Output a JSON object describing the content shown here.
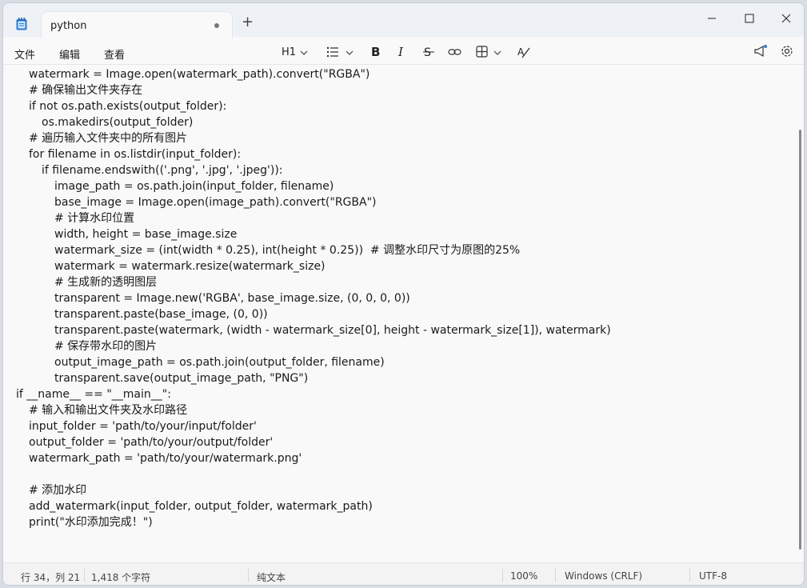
{
  "tab": {
    "title": "python"
  },
  "menu": {
    "file": "文件",
    "edit": "编辑",
    "view": "查看"
  },
  "toolbar": {
    "heading": "H1"
  },
  "code_lines": [
    {
      "indent": 1,
      "text": "watermark = Image.open(watermark_path).convert(\"RGBA\")"
    },
    {
      "indent": 1,
      "text": "# 确保输出文件夹存在"
    },
    {
      "indent": 1,
      "text": "if not os.path.exists(output_folder):"
    },
    {
      "indent": 2,
      "text": "os.makedirs(output_folder)"
    },
    {
      "indent": 1,
      "text": "# 遍历输入文件夹中的所有图片"
    },
    {
      "indent": 1,
      "text": "for filename in os.listdir(input_folder):"
    },
    {
      "indent": 2,
      "text": "if filename.endswith(('.png', '.jpg', '.jpeg')):"
    },
    {
      "indent": 3,
      "text": "image_path = os.path.join(input_folder, filename)"
    },
    {
      "indent": 3,
      "text": "base_image = Image.open(image_path).convert(\"RGBA\")"
    },
    {
      "indent": 3,
      "text": "# 计算水印位置"
    },
    {
      "indent": 3,
      "text": "width, height = base_image.size"
    },
    {
      "indent": 3,
      "text": "watermark_size = (int(width * 0.25), int(height * 0.25))  # 调整水印尺寸为原图的25%"
    },
    {
      "indent": 3,
      "text": "watermark = watermark.resize(watermark_size)"
    },
    {
      "indent": 3,
      "text": "# 生成新的透明图层"
    },
    {
      "indent": 3,
      "text": "transparent = Image.new('RGBA', base_image.size, (0, 0, 0, 0))"
    },
    {
      "indent": 3,
      "text": "transparent.paste(base_image, (0, 0))"
    },
    {
      "indent": 3,
      "text": "transparent.paste(watermark, (width - watermark_size[0], height - watermark_size[1]), watermark)"
    },
    {
      "indent": 3,
      "text": "# 保存带水印的图片"
    },
    {
      "indent": 3,
      "text": "output_image_path = os.path.join(output_folder, filename)"
    },
    {
      "indent": 3,
      "text": "transparent.save(output_image_path, \"PNG\")"
    },
    {
      "indent": 0,
      "text": "if __name__ == \"__main__\":"
    },
    {
      "indent": 1,
      "text": "# 输入和输出文件夹及水印路径"
    },
    {
      "indent": 1,
      "text": "input_folder = 'path/to/your/input/folder'"
    },
    {
      "indent": 1,
      "text": "output_folder = 'path/to/your/output/folder'"
    },
    {
      "indent": 1,
      "text": "watermark_path = 'path/to/your/watermark.png'"
    },
    {
      "indent": 1,
      "text": ""
    },
    {
      "indent": 1,
      "text": "# 添加水印"
    },
    {
      "indent": 1,
      "text": "add_watermark(input_folder, output_folder, watermark_path)"
    },
    {
      "indent": 1,
      "text": "print(\"水印添加完成！\")"
    }
  ],
  "status": {
    "position": "行 34，列 21",
    "chars": "1,418 个字符",
    "format": "纯文本",
    "zoom": "100%",
    "line_ending": "Windows (CRLF)",
    "encoding": "UTF-8"
  }
}
